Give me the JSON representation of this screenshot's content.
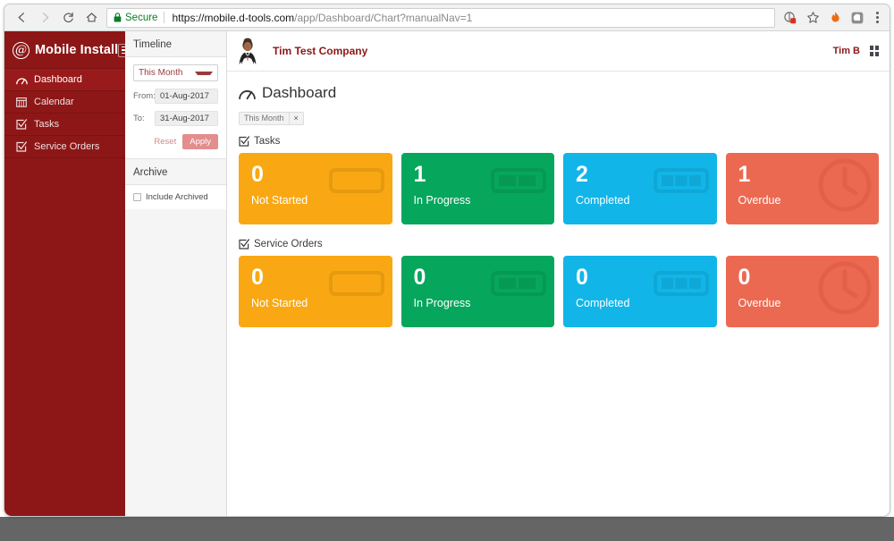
{
  "browser": {
    "back_icon": "back-arrow-icon",
    "forward_icon": "forward-arrow-icon",
    "reload_icon": "reload-icon",
    "home_icon": "home-icon",
    "lock_icon": "lock-icon",
    "secure_label": "Secure",
    "url_host": "https://mobile.d-tools.com",
    "url_path": "/app/Dashboard/Chart?manualNav=1",
    "url_full": "https://mobile.d-tools.com/app/Dashboard/Chart?manualNav=1",
    "extension_icon": "extension-badge-icon",
    "bookmark_icon": "star-icon",
    "flame_icon": "flame-extension-icon",
    "square_icon": "square-extension-icon",
    "menu_icon": "kebab-menu-icon"
  },
  "sidebar": {
    "logo_glyph": "@",
    "brand": "Mobile Install",
    "menu_icon": "hamburger-icon",
    "items": [
      {
        "label": "Dashboard",
        "icon": "gauge-icon",
        "active": true
      },
      {
        "label": "Calendar",
        "icon": "calendar-icon",
        "active": false
      },
      {
        "label": "Tasks",
        "icon": "checkbox-check-icon",
        "active": false
      },
      {
        "label": "Service Orders",
        "icon": "checkbox-check-icon",
        "active": false
      }
    ]
  },
  "filters": {
    "timeline_heading": "Timeline",
    "range_selected": "This Month",
    "from_label": "From:",
    "from_value": "01-Aug-2017",
    "to_label": "To:",
    "to_value": "31-Aug-2017",
    "reset_label": "Reset",
    "apply_label": "Apply",
    "archive_heading": "Archive",
    "include_archived_label": "Include Archived",
    "include_archived_checked": false
  },
  "topbar": {
    "avatar_icon": "user-avatar-icon",
    "company": "Tim Test Company",
    "user": "Tim B",
    "apps_icon": "grid-apps-icon"
  },
  "page": {
    "title": "Dashboard",
    "title_icon": "gauge-icon",
    "filter_chip": "This Month",
    "filter_chip_close": "×"
  },
  "colors": {
    "not_started": "#F9A813",
    "in_progress": "#06A65D",
    "completed": "#12B5E8",
    "overdue": "#EC6951",
    "brand_red": "#8D1717"
  },
  "sections": [
    {
      "heading": "Tasks",
      "icon": "checkbox-check-icon",
      "cards": [
        {
          "count": "0",
          "label": "Not Started",
          "color": "#F9A813",
          "deco": "progress-0-icon"
        },
        {
          "count": "1",
          "label": "In Progress",
          "color": "#06A65D",
          "deco": "progress-2-icon"
        },
        {
          "count": "2",
          "label": "Completed",
          "color": "#12B5E8",
          "deco": "progress-3-icon"
        },
        {
          "count": "1",
          "label": "Overdue",
          "color": "#EC6951",
          "deco": "clock-icon"
        }
      ]
    },
    {
      "heading": "Service Orders",
      "icon": "checkbox-check-icon",
      "cards": [
        {
          "count": "0",
          "label": "Not Started",
          "color": "#F9A813",
          "deco": "progress-0-icon"
        },
        {
          "count": "0",
          "label": "In Progress",
          "color": "#06A65D",
          "deco": "progress-2-icon"
        },
        {
          "count": "0",
          "label": "Completed",
          "color": "#12B5E8",
          "deco": "progress-3-icon"
        },
        {
          "count": "0",
          "label": "Overdue",
          "color": "#EC6951",
          "deco": "clock-icon"
        }
      ]
    }
  ]
}
